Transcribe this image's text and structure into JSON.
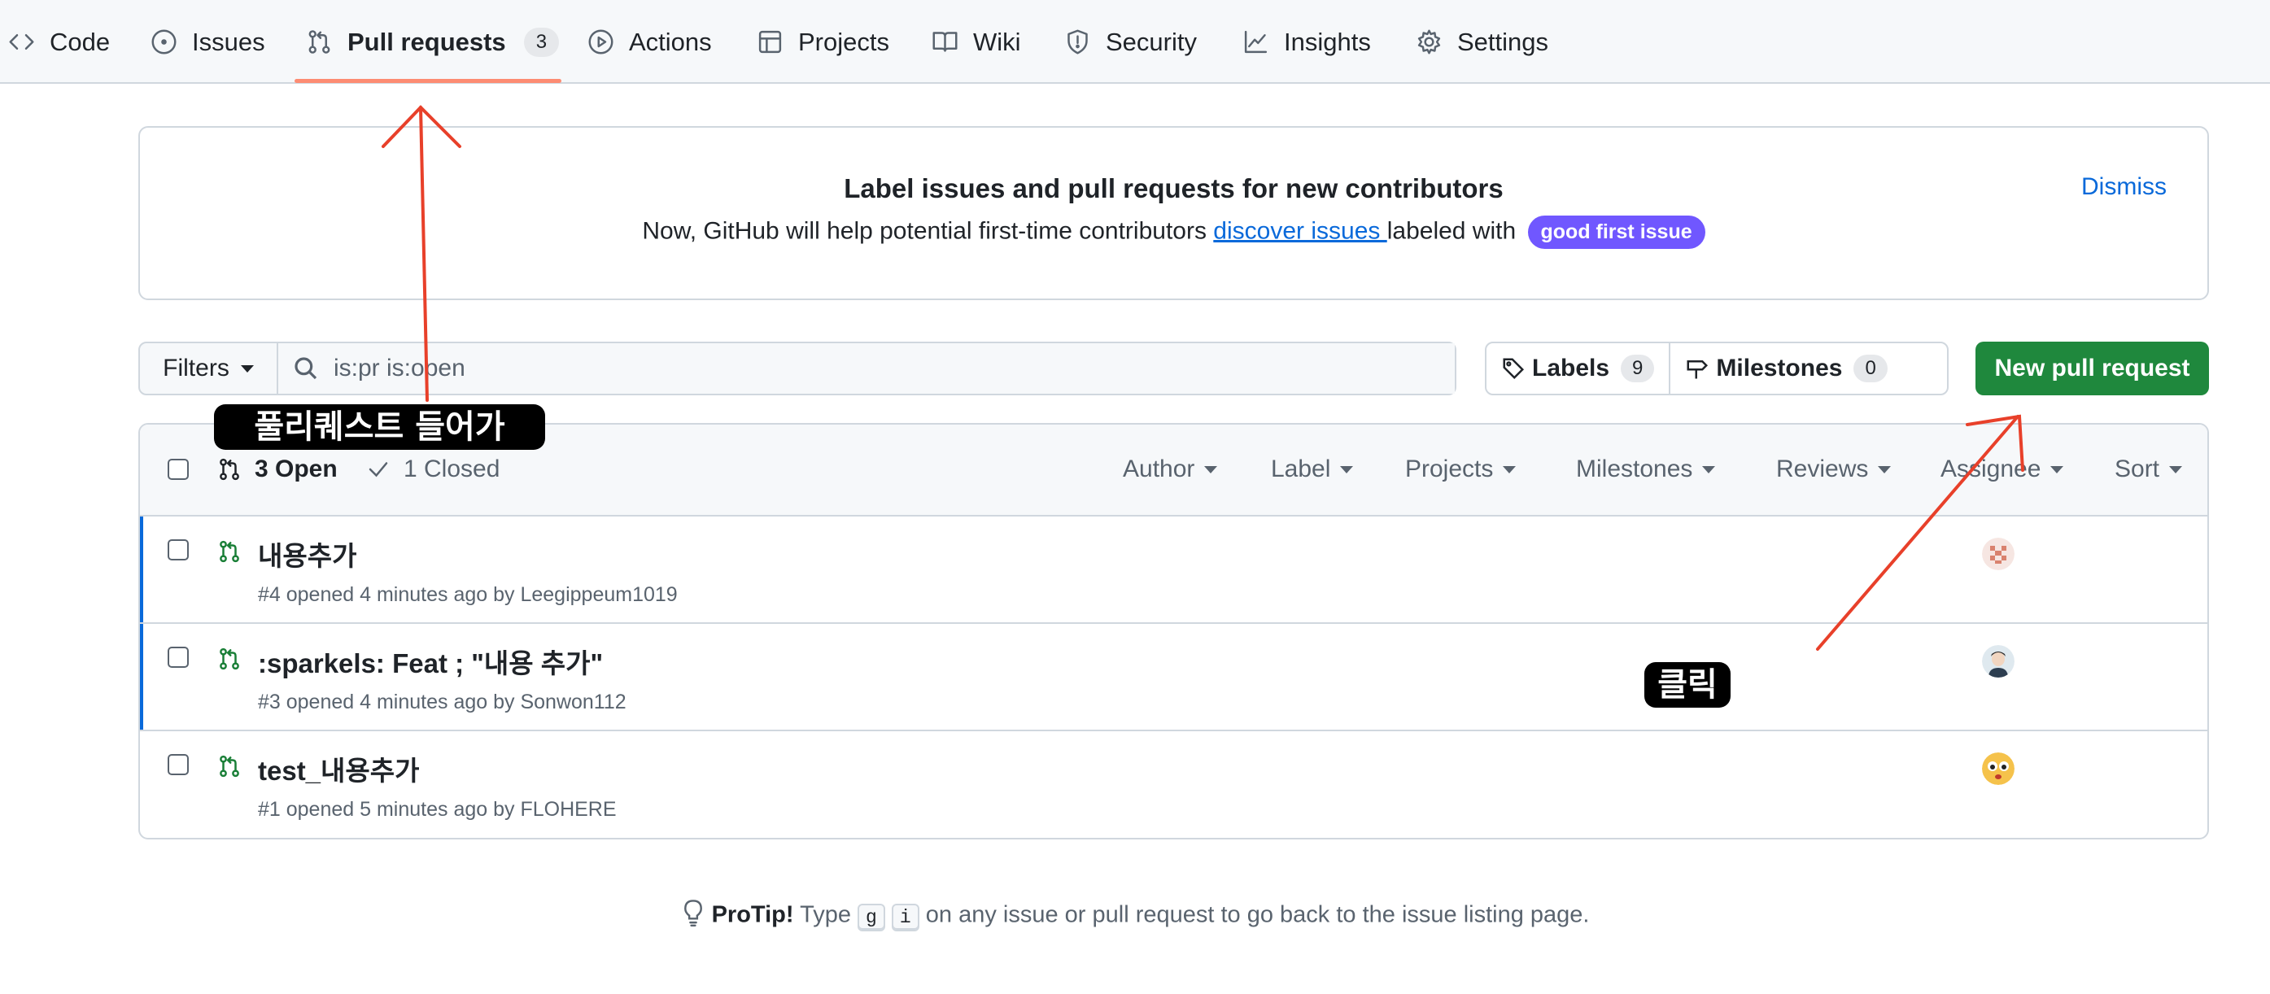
{
  "nav": {
    "tabs": [
      {
        "label": "Code",
        "icon": "code-icon"
      },
      {
        "label": "Issues",
        "icon": "issue-opened-icon"
      },
      {
        "label": "Pull requests",
        "icon": "git-pull-request-icon",
        "count": "3",
        "active": true
      },
      {
        "label": "Actions",
        "icon": "play-icon"
      },
      {
        "label": "Projects",
        "icon": "table-icon"
      },
      {
        "label": "Wiki",
        "icon": "book-icon"
      },
      {
        "label": "Security",
        "icon": "shield-icon"
      },
      {
        "label": "Insights",
        "icon": "graph-icon"
      },
      {
        "label": "Settings",
        "icon": "gear-icon"
      }
    ],
    "active_color": "#fd8c73"
  },
  "banner": {
    "title": "Label issues and pull requests for new contributors",
    "text_before": "Now, GitHub will help potential first-time contributors ",
    "link": "discover issues ",
    "text_after": "labeled with ",
    "label": "good first issue",
    "label_color": "#7057ff",
    "dismiss": "Dismiss"
  },
  "filters": {
    "button": "Filters",
    "search_value": "is:pr is:open"
  },
  "labels_group": {
    "labels": "Labels",
    "labels_count": "9",
    "milestones": "Milestones",
    "milestones_count": "0"
  },
  "new_pr_button": "New pull request",
  "list_header": {
    "open": "3 Open",
    "closed": "1 Closed",
    "filters": [
      "Author",
      "Label",
      "Projects",
      "Milestones",
      "Reviews",
      "Assignee",
      "Sort"
    ]
  },
  "pull_requests": [
    {
      "title": "내용추가",
      "meta": "#4 opened 4 minutes ago by Leegippeum1019",
      "unread": true
    },
    {
      "title": ":sparkels: Feat ; \"내용 추가\"",
      "meta": "#3 opened 4 minutes ago by Sonwon112",
      "unread": true
    },
    {
      "title": "test_내용추가",
      "meta": "#1 opened 5 minutes ago by FLOHERE",
      "unread": false
    }
  ],
  "protip": {
    "bold": "ProTip!",
    "before": " Type ",
    "key1": "g",
    "key2": "i",
    "after": " on any issue or pull request to go back to the issue listing page."
  },
  "annotations": {
    "callout_tab": "풀리퀘스트 들어가",
    "callout_click": "클릭",
    "arrow_color": "#e8402a"
  },
  "colors": {
    "primary_button": "#1f883d",
    "link": "#0969da",
    "open_pr": "#1a7f37"
  }
}
